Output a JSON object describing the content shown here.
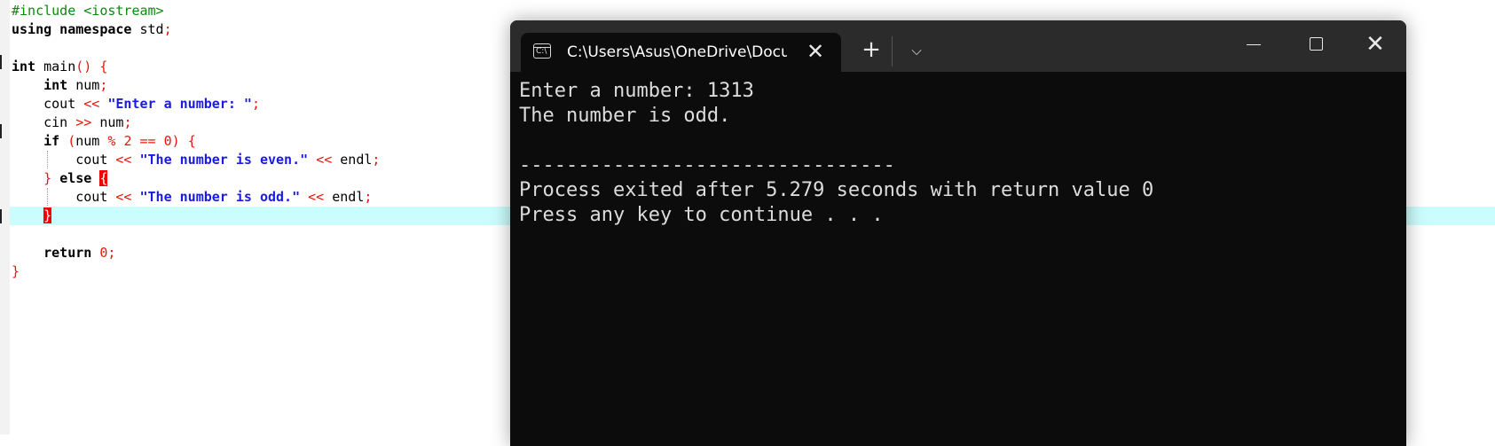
{
  "editor": {
    "lines": [
      [
        {
          "t": "#include <iostream>",
          "c": "pp"
        }
      ],
      [
        {
          "t": "using namespace",
          "c": "kw"
        },
        {
          "t": " std"
        },
        {
          "t": ";",
          "c": "op"
        }
      ],
      [
        {
          "t": ""
        }
      ],
      [
        {
          "t": "int",
          "c": "kw"
        },
        {
          "t": " main"
        },
        {
          "t": "() {",
          "c": "op"
        }
      ],
      [
        {
          "t": "    "
        },
        {
          "t": "int",
          "c": "kw"
        },
        {
          "t": " num"
        },
        {
          "t": ";",
          "c": "op"
        }
      ],
      [
        {
          "t": "    cout "
        },
        {
          "t": "<<",
          "c": "op"
        },
        {
          "t": " "
        },
        {
          "t": "\"Enter a number: \"",
          "c": "str"
        },
        {
          "t": ";",
          "c": "op"
        }
      ],
      [
        {
          "t": "    cin "
        },
        {
          "t": ">>",
          "c": "op"
        },
        {
          "t": " num"
        },
        {
          "t": ";",
          "c": "op"
        }
      ],
      [
        {
          "t": "    "
        },
        {
          "t": "if",
          "c": "kw"
        },
        {
          "t": " "
        },
        {
          "t": "(",
          "c": "op"
        },
        {
          "t": "num "
        },
        {
          "t": "%",
          "c": "op"
        },
        {
          "t": " "
        },
        {
          "t": "2",
          "c": "num"
        },
        {
          "t": " "
        },
        {
          "t": "==",
          "c": "op"
        },
        {
          "t": " "
        },
        {
          "t": "0",
          "c": "num"
        },
        {
          "t": ")",
          "c": "op"
        },
        {
          "t": " "
        },
        {
          "t": "{",
          "c": "op"
        }
      ],
      [
        {
          "t": "        cout "
        },
        {
          "t": "<<",
          "c": "op"
        },
        {
          "t": " "
        },
        {
          "t": "\"The number is even.\"",
          "c": "str"
        },
        {
          "t": " "
        },
        {
          "t": "<<",
          "c": "op"
        },
        {
          "t": " endl"
        },
        {
          "t": ";",
          "c": "op"
        }
      ],
      [
        {
          "t": "    "
        },
        {
          "t": "}",
          "c": "op"
        },
        {
          "t": " "
        },
        {
          "t": "else",
          "c": "kw"
        },
        {
          "t": " "
        },
        {
          "t": "{",
          "c": "brk-match"
        }
      ],
      [
        {
          "t": "        cout "
        },
        {
          "t": "<<",
          "c": "op"
        },
        {
          "t": " "
        },
        {
          "t": "\"The number is odd.\"",
          "c": "str"
        },
        {
          "t": " "
        },
        {
          "t": "<<",
          "c": "op"
        },
        {
          "t": " endl"
        },
        {
          "t": ";",
          "c": "op"
        }
      ],
      [
        {
          "t": "    "
        },
        {
          "t": "}",
          "c": "brk-match"
        }
      ],
      [
        {
          "t": ""
        }
      ],
      [
        {
          "t": "    "
        },
        {
          "t": "return",
          "c": "kw"
        },
        {
          "t": " "
        },
        {
          "t": "0",
          "c": "num"
        },
        {
          "t": ";",
          "c": "op"
        }
      ],
      [
        {
          "t": "}",
          "c": "op"
        }
      ]
    ]
  },
  "terminal": {
    "tab_title": "C:\\Users\\Asus\\OneDrive\\Documents",
    "tab_icon_text": "C:\\",
    "tab_close": "✕",
    "new_tab": "+",
    "dropdown": "⌵",
    "close": "✕",
    "output": [
      "Enter a number: 1313",
      "The number is odd.",
      "",
      "--------------------------------",
      "Process exited after 5.279 seconds with return value 0",
      "Press any key to continue . . ."
    ]
  },
  "colors": {
    "preprocessor": "#0a8a0a",
    "operator": "#e8160c",
    "string": "#1a1ae6",
    "current_line": "#ccfdfd",
    "terminal_bg": "#0c0c0c",
    "titlebar_bg": "#2b2b2b"
  }
}
